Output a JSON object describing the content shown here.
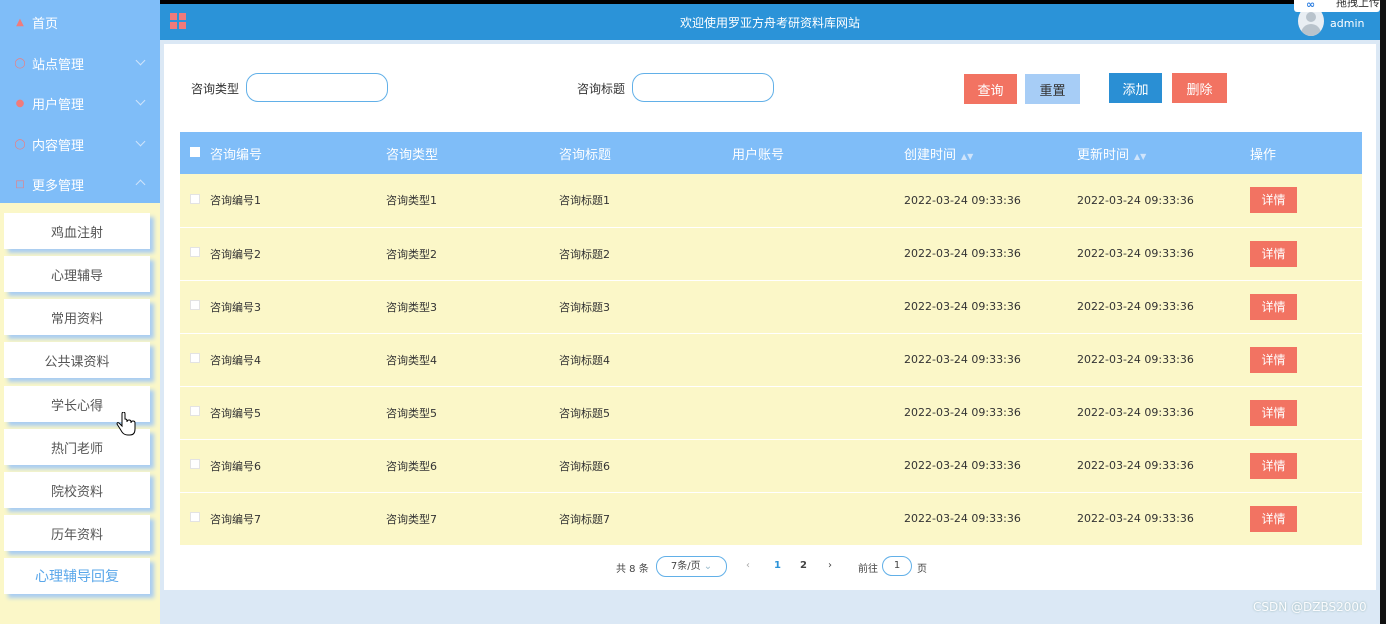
{
  "app": {
    "title": "欢迎使用罗亚方舟考研资料库网站",
    "user": "admin",
    "badge": "拖拽上传",
    "watermark": "CSDN @DZBS2000"
  },
  "sidebar": {
    "items": [
      {
        "label": "首页",
        "icon": "home-icon"
      },
      {
        "label": "站点管理",
        "icon": "shield-icon"
      },
      {
        "label": "用户管理",
        "icon": "user-icon"
      },
      {
        "label": "内容管理",
        "icon": "clock-icon"
      },
      {
        "label": "更多管理",
        "icon": "book-icon"
      }
    ],
    "submenu": [
      "鸡血注射",
      "心理辅导",
      "常用资料",
      "公共课资料",
      "学长心得",
      "热门老师",
      "院校资料",
      "历年资料",
      "心理辅导回复"
    ]
  },
  "search": {
    "type_label": "咨询类型",
    "title_label": "咨询标题",
    "type_value": "",
    "title_value": ""
  },
  "buttons": {
    "query": "查询",
    "reset": "重置",
    "add": "添加",
    "delete": "删除"
  },
  "table": {
    "headers": [
      "咨询编号",
      "咨询类型",
      "咨询标题",
      "用户账号",
      "创建时间",
      "更新时间",
      "操作"
    ],
    "detail_label": "详情",
    "rows": [
      {
        "no": "咨询编号1",
        "type": "咨询类型1",
        "title": "咨询标题1",
        "account": "",
        "created": "2022-03-24 09:33:36",
        "updated": "2022-03-24 09:33:36"
      },
      {
        "no": "咨询编号2",
        "type": "咨询类型2",
        "title": "咨询标题2",
        "account": "",
        "created": "2022-03-24 09:33:36",
        "updated": "2022-03-24 09:33:36"
      },
      {
        "no": "咨询编号3",
        "type": "咨询类型3",
        "title": "咨询标题3",
        "account": "",
        "created": "2022-03-24 09:33:36",
        "updated": "2022-03-24 09:33:36"
      },
      {
        "no": "咨询编号4",
        "type": "咨询类型4",
        "title": "咨询标题4",
        "account": "",
        "created": "2022-03-24 09:33:36",
        "updated": "2022-03-24 09:33:36"
      },
      {
        "no": "咨询编号5",
        "type": "咨询类型5",
        "title": "咨询标题5",
        "account": "",
        "created": "2022-03-24 09:33:36",
        "updated": "2022-03-24 09:33:36"
      },
      {
        "no": "咨询编号6",
        "type": "咨询类型6",
        "title": "咨询标题6",
        "account": "",
        "created": "2022-03-24 09:33:36",
        "updated": "2022-03-24 09:33:36"
      },
      {
        "no": "咨询编号7",
        "type": "咨询类型7",
        "title": "咨询标题7",
        "account": "",
        "created": "2022-03-24 09:33:36",
        "updated": "2022-03-24 09:33:36"
      }
    ]
  },
  "pager": {
    "total": "共 8 条",
    "page_size": "7条/页",
    "pages": [
      "1",
      "2"
    ],
    "goto_label": "前往",
    "goto_value": "1",
    "page_suffix": "页"
  }
}
